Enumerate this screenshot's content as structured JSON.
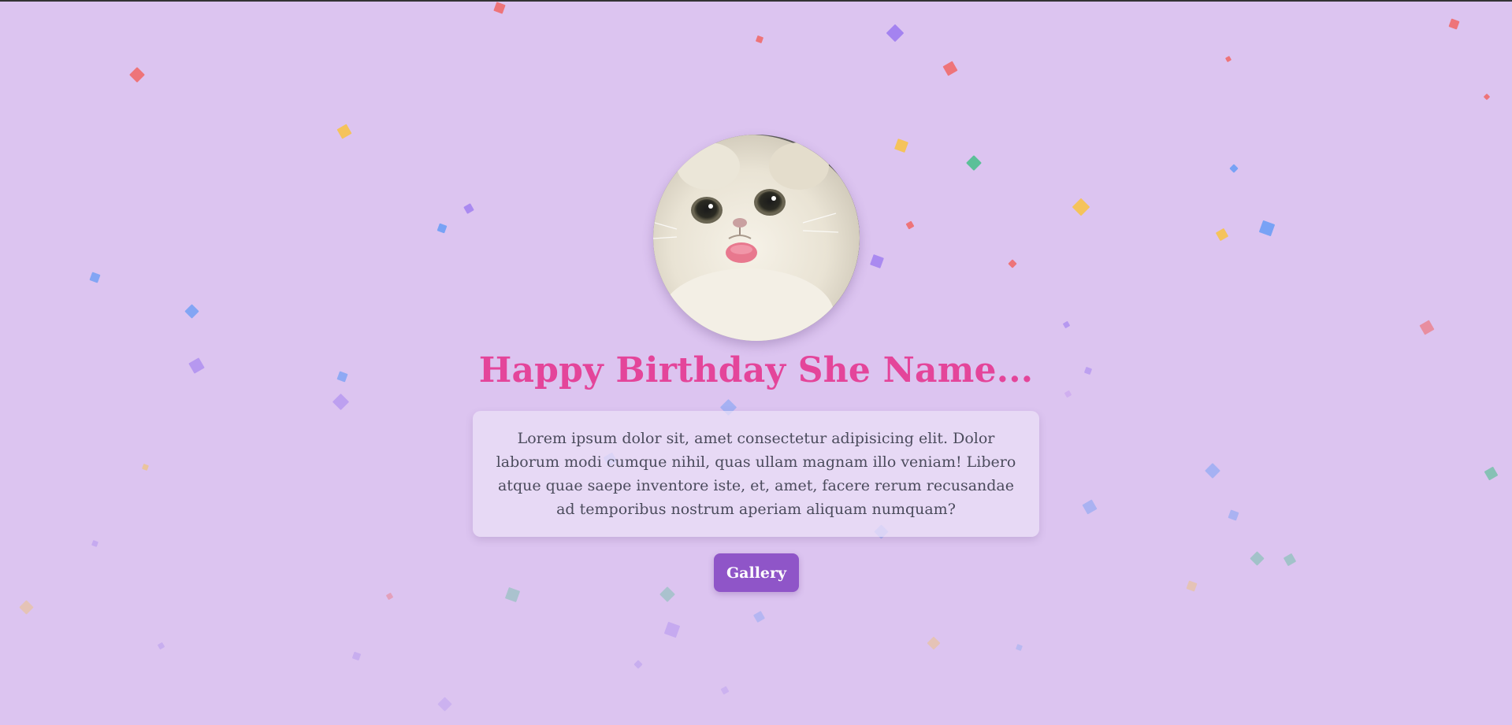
{
  "heading": "Happy Birthday She Name...",
  "message": "Lorem ipsum dolor sit, amet consectetur adipisicing elit. Dolor laborum modi cumque nihil, quas ullam magnam illo veniam! Libero atque quae saepe inventore iste, et, amet, facere rerum recusandae ad temporibus nostrum aperiam aliquam numquam?",
  "button_label": "Gallery",
  "photo": "white-fluffy-cat-with-tongue-out",
  "colors": {
    "background": "#dcc4f0",
    "heading": "#e4459a",
    "button": "#8f55c8",
    "confetti": [
      "#f06b6b",
      "#9d7cf0",
      "#f7c34a",
      "#6d9ef5",
      "#4cc08e",
      "#c39af0"
    ]
  }
}
